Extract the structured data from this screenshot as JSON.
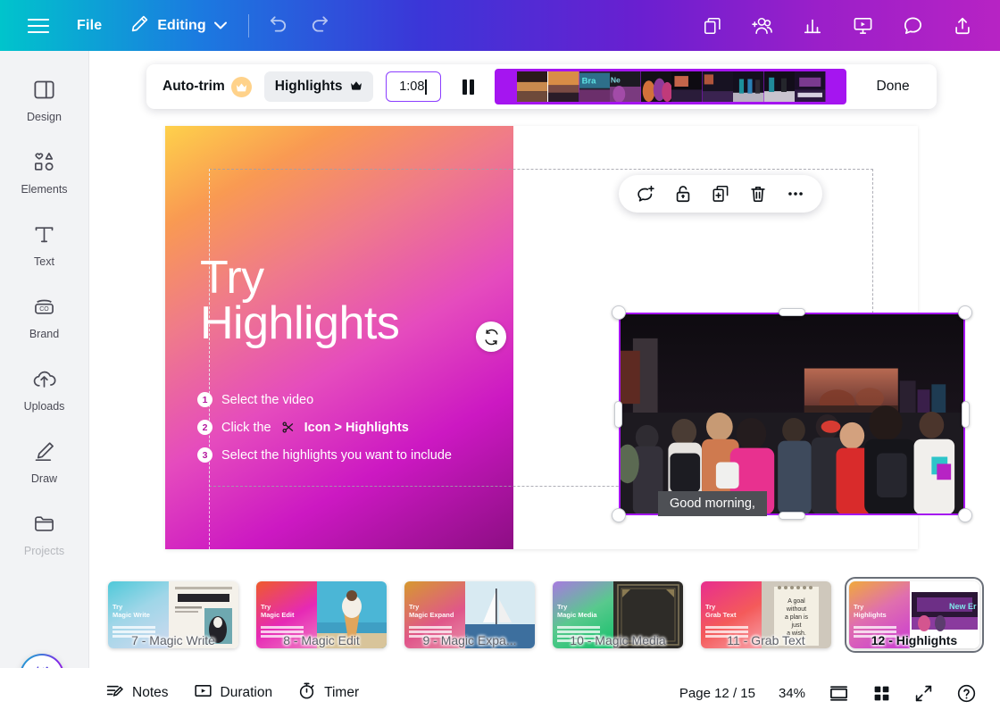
{
  "topbar": {
    "menu_icon": "hamburger-icon",
    "file_label": "File",
    "editing_label": "Editing",
    "editing_icon": "pencil-icon",
    "chevron_icon": "chevron-down-icon",
    "undo_icon": "undo-icon",
    "redo_icon": "redo-icon",
    "right_icons": [
      {
        "name": "duplicate-page-icon"
      },
      {
        "name": "add-collaborator-icon"
      },
      {
        "name": "analytics-icon"
      },
      {
        "name": "present-icon"
      },
      {
        "name": "comment-icon"
      },
      {
        "name": "share-icon"
      }
    ],
    "gradient_from": "#00c4cc",
    "gradient_to": "#b723c4"
  },
  "sidebar": {
    "items": [
      {
        "label": "Design",
        "icon": "design-icon"
      },
      {
        "label": "Elements",
        "icon": "elements-icon"
      },
      {
        "label": "Text",
        "icon": "text-icon"
      },
      {
        "label": "Brand",
        "icon": "brand-icon"
      },
      {
        "label": "Uploads",
        "icon": "uploads-icon"
      },
      {
        "label": "Draw",
        "icon": "draw-icon"
      },
      {
        "label": "Projects",
        "icon": "projects-icon"
      }
    ],
    "magic_button_icon": "sparkle-icon"
  },
  "timeline_toolbar": {
    "autotrim_label": "Auto-trim",
    "autotrim_badge_icon": "crown-icon",
    "highlights_label": "Highlights",
    "highlights_icon": "crown-icon",
    "time_value": "1:08",
    "pause_icon": "pause-icon",
    "done_label": "Done",
    "selection_color": "#a515f0"
  },
  "canvas": {
    "slide_title_line1": "Try",
    "slide_title_line2": "Highlights",
    "steps": [
      {
        "num": "1",
        "text": "Select the video",
        "bold": ""
      },
      {
        "num": "2",
        "text": "Click the ",
        "bold": "Icon > Highlights",
        "icon": "scissors-icon"
      },
      {
        "num": "3",
        "text": "Select the highlights you want to include",
        "bold": ""
      }
    ],
    "rotate_icon": "rotate-icon",
    "caption_text": "Good morning,",
    "float_tools": [
      {
        "name": "add-comment-icon"
      },
      {
        "name": "unlock-icon"
      },
      {
        "name": "duplicate-icon"
      },
      {
        "name": "delete-icon"
      },
      {
        "name": "more-options-icon"
      }
    ],
    "gradient_start": "#fed14b",
    "gradient_end": "#8d0e84"
  },
  "thumbnails": [
    {
      "label": "7 - Magic Write",
      "title": "Try\nMagic Write",
      "grad_a": "#4fc9d9",
      "grad_b": "#cfd9ef",
      "selected": false
    },
    {
      "label": "8 - Magic Edit",
      "title": "Try\nMagic Edit",
      "grad_a": "#ef5b2b",
      "grad_b": "#e629b5",
      "selected": false
    },
    {
      "label": "9 - Magic Expa...",
      "title": "Try\nMagic Expand",
      "grad_a": "#d6992f",
      "grad_b": "#e0568a",
      "selected": false
    },
    {
      "label": "10 - Magic Media",
      "title": "Try\nMagic Media",
      "grad_a": "#a77ae0",
      "grad_b": "#14c06a",
      "selected": false
    },
    {
      "label": "11 - Grab Text",
      "title": "Try\nGrab Text",
      "grad_a": "#e82e8e",
      "grad_b": "#f45a5a",
      "selected": false
    },
    {
      "label": "12 - Highlights",
      "title": "Try\nHighlights",
      "grad_a": "#f0a93c",
      "grad_b": "#c93ad4",
      "selected": true
    }
  ],
  "status_bar": {
    "notes_label": "Notes",
    "notes_icon": "notes-icon",
    "duration_label": "Duration",
    "duration_icon": "duration-icon",
    "timer_label": "Timer",
    "timer_icon": "timer-icon",
    "page_label": "Page 12 / 15",
    "zoom_label": "34%",
    "view_icon": "single-page-icon",
    "grid_icon": "grid-view-icon",
    "fullscreen_icon": "fullscreen-icon",
    "help_icon": "help-icon"
  }
}
